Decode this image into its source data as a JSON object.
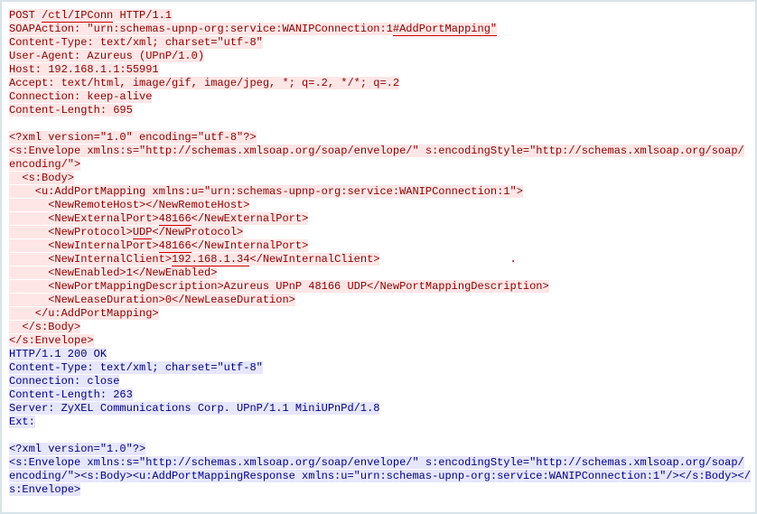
{
  "request": {
    "method": "POST",
    "path": "/ctl/IPConn",
    "version": "HTTP/1.1",
    "soapaction_prefix": "\"urn:schemas-upnp-org:service:WANIPConnection:1",
    "soapaction_suffix": "#AddPortMapping\"",
    "content_type": "Content-Type: text/xml; charset=\"utf-8\"",
    "user_agent": "User-Agent: Azureus (UPnP/1.0)",
    "host": "Host: 192.168.1.1:55991",
    "accept": "Accept: text/html, image/gif, image/jpeg, *; q=.2, */*; q=.2",
    "connection": "Connection: keep-alive",
    "content_length": "Content-Length: 695",
    "xml_decl": "<?xml version=\"1.0\" encoding=\"utf-8\"?>",
    "env_open": "<s:Envelope xmlns:s=\"http://schemas.xmlsoap.org/soap/envelope/\" s:encodingStyle=\"http://schemas.xmlsoap.org/soap/",
    "env_open2": "encoding/\">",
    "body_open": "  <s:Body>",
    "add_open": "    <u:AddPortMapping xmlns:u=\"urn:schemas-upnp-org:service:WANIPConnection:1\">",
    "remote_host": "      <NewRemoteHost></NewRemoteHost>",
    "ext_port_pre": "      <NewExternalPort>",
    "ext_port_val": "48166",
    "ext_port_post": "</NewExternalPort>",
    "proto_pre": "      <NewProtocol>",
    "proto_val": "UDP",
    "proto_post": "</NewProtocol>",
    "int_port_pre": "      <NewInternalPort>",
    "int_port_val": "48166",
    "int_port_post": "</NewInternalPort>",
    "int_client_pre": "      <NewInternalClient>",
    "int_client_val": "192.168.1.34",
    "int_client_post": "</NewInternalClient>",
    "enabled": "      <NewEnabled>1</NewEnabled>",
    "desc": "      <NewPortMappingDescription>Azureus UPnP 48166 UDP</NewPortMappingDescription>",
    "lease": "      <NewLeaseDuration>0</NewLeaseDuration>",
    "add_close": "    </u:AddPortMapping>",
    "body_close": "  </s:Body>",
    "env_close": "</s:Envelope>"
  },
  "response": {
    "status": "HTTP/1.1 200 OK",
    "content_type": "Content-Type: text/xml; charset=\"utf-8\"",
    "connection": "Connection: close",
    "content_length": "Content-Length: 263",
    "server": "Server: ZyXEL Communications Corp. UPnP/1.1 MiniUPnPd/1.8",
    "ext": "Ext:",
    "xml_decl": "<?xml version=\"1.0\"?>",
    "body1": "<s:Envelope xmlns:s=\"http://schemas.xmlsoap.org/soap/envelope/\" s:encodingStyle=\"http://schemas.xmlsoap.org/soap/",
    "body2": "encoding/\"><s:Body><u:AddPortMappingResponse xmlns:u=\"urn:schemas-upnp-org:service:WANIPConnection:1\"/></s:Body></",
    "body3": "s:Envelope>"
  },
  "marker": "."
}
